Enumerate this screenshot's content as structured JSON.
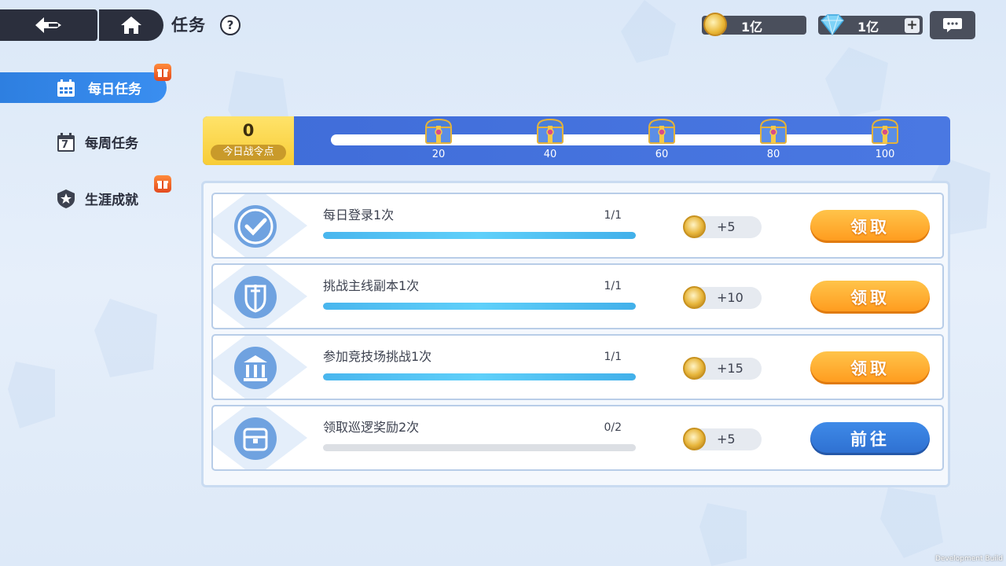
{
  "header": {
    "title": "任务",
    "help": "?",
    "coins": "1亿",
    "gems": "1亿",
    "gems_plus": "+"
  },
  "sidebar": {
    "items": [
      {
        "label": "每日任务",
        "active": true,
        "badge": "gift-icon"
      },
      {
        "label": "每周任务",
        "active": false,
        "icon_number": "7"
      },
      {
        "label": "生涯成就",
        "active": false,
        "badge": "gift-icon"
      }
    ]
  },
  "progress": {
    "points": "0",
    "points_label": "今日战令点",
    "fill_fraction": 0,
    "milestones": [
      "20",
      "40",
      "60",
      "80",
      "100"
    ]
  },
  "tasks": [
    {
      "title": "每日登录1次",
      "count": "1/1",
      "progress": 1.0,
      "reward": "+5",
      "action": "领取",
      "action_type": "claim",
      "icon": "check-shield-icon"
    },
    {
      "title": "挑战主线副本1次",
      "count": "1/1",
      "progress": 1.0,
      "reward": "+10",
      "action": "领取",
      "action_type": "claim",
      "icon": "sword-shield-icon"
    },
    {
      "title": "参加竞技场挑战1次",
      "count": "1/1",
      "progress": 1.0,
      "reward": "+15",
      "action": "领取",
      "action_type": "claim",
      "icon": "arena-pillar-icon"
    },
    {
      "title": "领取巡逻奖励2次",
      "count": "0/2",
      "progress": 0.0,
      "reward": "+5",
      "action": "前往",
      "action_type": "go",
      "icon": "patrol-chest-icon"
    }
  ],
  "footer": {
    "dev_build": "Development Build"
  },
  "colors": {
    "accent_blue": "#3a8ef0",
    "claim_orange": "#ff9a1c",
    "go_blue": "#2e6fd0",
    "progress_cyan": "#5fd0fa"
  }
}
